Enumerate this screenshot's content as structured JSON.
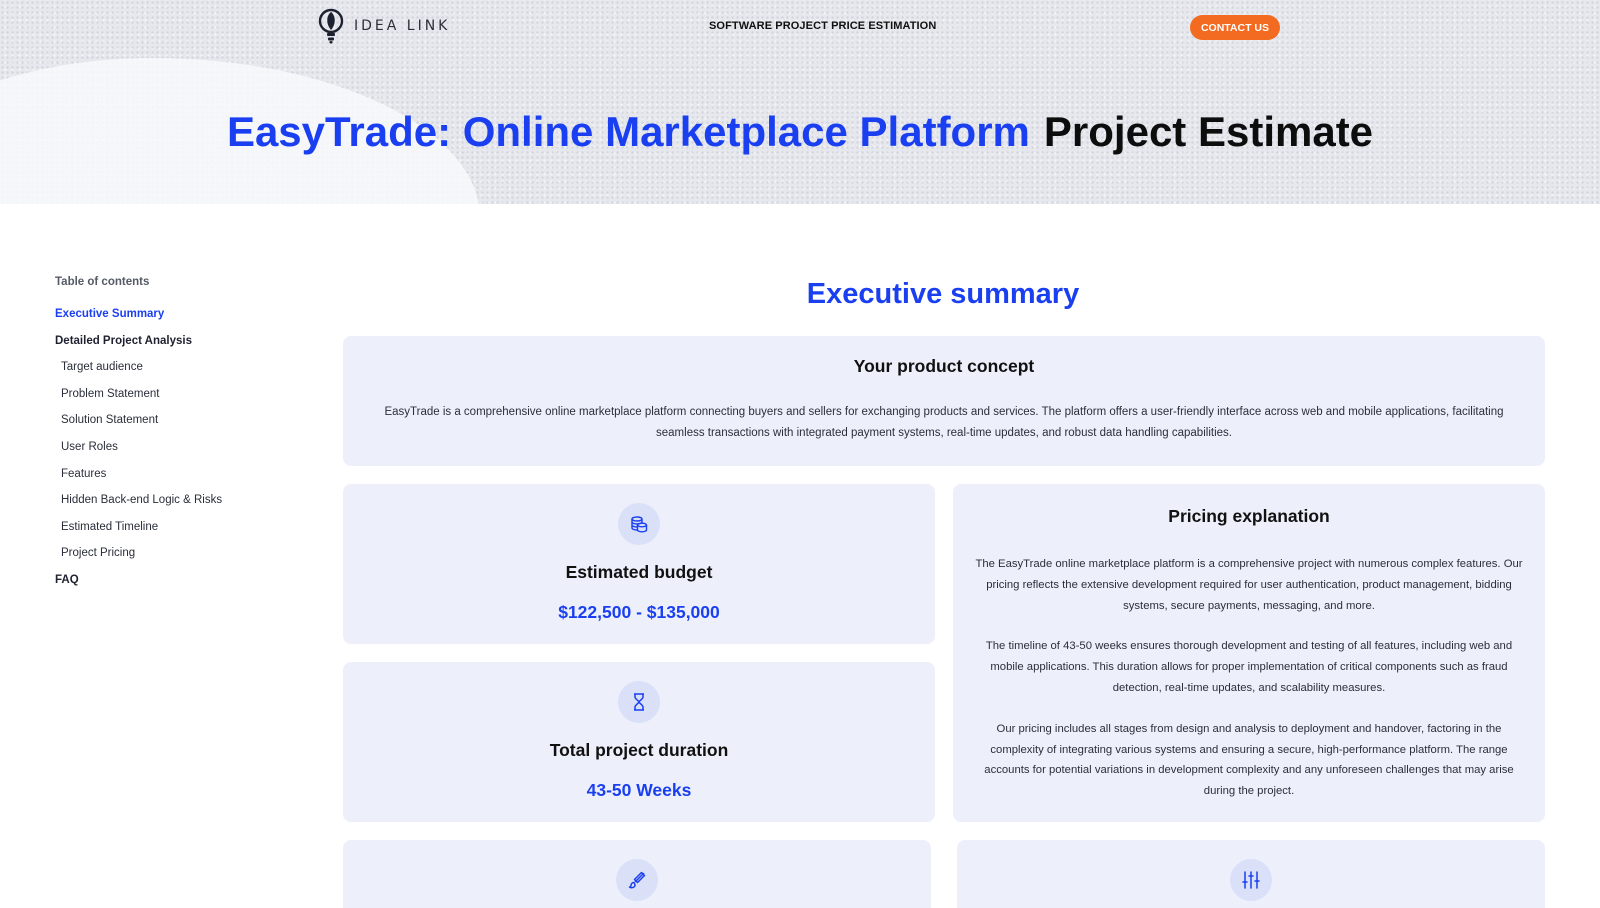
{
  "header": {
    "logo_text": "IDEA LINK",
    "nav_title": "SOFTWARE PROJECT PRICE ESTIMATION",
    "contact_label": "CONTACT US",
    "title_highlight": "EasyTrade: Online Marketplace Platform",
    "title_rest": "Project Estimate"
  },
  "toc": {
    "heading": "Table of contents",
    "items": [
      {
        "label": "Executive Summary"
      },
      {
        "label": "Detailed Project Analysis"
      },
      {
        "label": "Target audience"
      },
      {
        "label": "Problem Statement"
      },
      {
        "label": "Solution Statement"
      },
      {
        "label": "User Roles"
      },
      {
        "label": "Features"
      },
      {
        "label": "Hidden Back-end Logic & Risks"
      },
      {
        "label": "Estimated Timeline"
      },
      {
        "label": "Project Pricing"
      },
      {
        "label": "FAQ"
      }
    ]
  },
  "main": {
    "section_title": "Executive summary",
    "concept": {
      "title": "Your product concept",
      "text": "EasyTrade is a comprehensive online marketplace platform connecting buyers and sellers for exchanging products and services. The platform offers a user-friendly interface across web and mobile applications, facilitating seamless transactions with integrated payment systems, real-time updates, and robust data handling capabilities."
    },
    "budget": {
      "title": "Estimated budget",
      "value": "$122,500 - $135,000",
      "icon": "coins-icon"
    },
    "duration": {
      "title": "Total project duration",
      "value": "43-50 Weeks",
      "icon": "hourglass-icon"
    },
    "pricing": {
      "title": "Pricing explanation",
      "paragraphs": [
        "The EasyTrade online marketplace platform is a comprehensive project with numerous complex features. Our pricing reflects the extensive development required for user authentication, product management, bidding systems, secure payments, messaging, and more.",
        "The timeline of 43-50 weeks ensures thorough development and testing of all features, including web and mobile applications. This duration allows for proper implementation of critical components such as fraud detection, real-time updates, and scalability measures.",
        "Our pricing includes all stages from design and analysis to deployment and handover, factoring in the complexity of integrating various systems and ensuring a secure, high-performance platform. The range accounts for potential variations in development complexity and any unforeseen challenges that may arise during the project."
      ]
    },
    "bottom_icons": [
      "brush-icon",
      "sliders-icon"
    ]
  },
  "colors": {
    "accent_blue": "#1a3ff0",
    "cta_orange": "#f36a21",
    "card_bg": "#edf0fb"
  }
}
